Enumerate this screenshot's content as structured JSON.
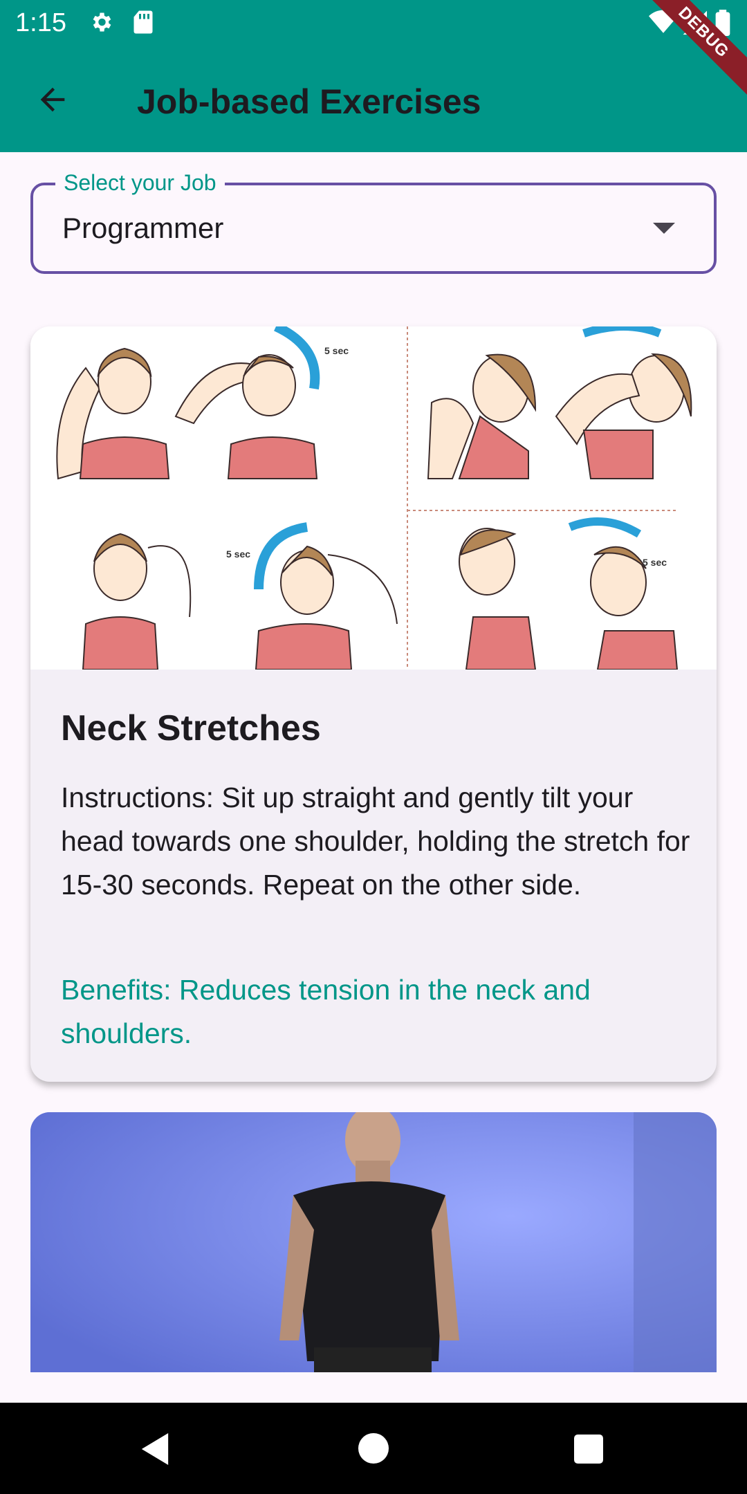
{
  "status_bar": {
    "time": "1:15",
    "debug_label": "DEBUG",
    "icons": [
      "gear-icon",
      "sd-card-icon",
      "wifi-icon",
      "signal-icon",
      "battery-icon"
    ]
  },
  "app_bar": {
    "title": "Job-based Exercises",
    "back_icon": "arrow-back-icon",
    "background": "#009688"
  },
  "job_select": {
    "label": "Select your Job",
    "value": "Programmer",
    "border_color": "#6750a4"
  },
  "exercises": [
    {
      "image": "neck-stretch-illustration",
      "title": "Neck Stretches",
      "instructions": "Instructions: Sit up straight and gently tilt your head towards one shoulder, holding the stretch for 15-30 seconds. Repeat on the other side.",
      "benefits": "Benefits: Reduces tension in the neck and shoulders."
    },
    {
      "image": "man-standing-photo"
    }
  ],
  "colors": {
    "accent": "#009688",
    "primary": "#6750a4",
    "background": "#fdf7fd",
    "card": "#f3eff6"
  },
  "nav_bar": {
    "icons": [
      "nav-back-icon",
      "nav-home-icon",
      "nav-recents-icon"
    ]
  }
}
